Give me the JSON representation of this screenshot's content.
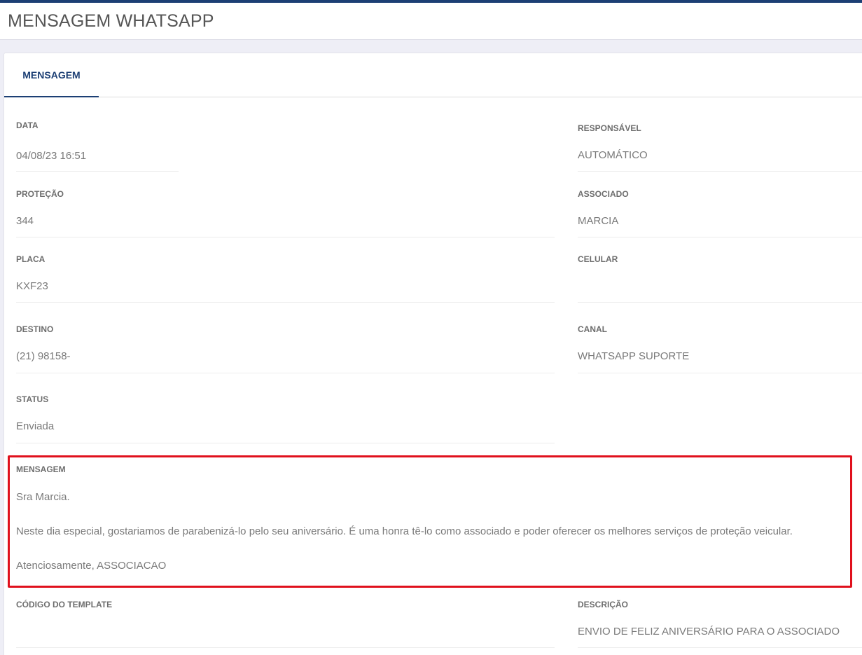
{
  "header": {
    "title": "MENSAGEM WHATSAPP"
  },
  "tabs": [
    {
      "label": "MENSAGEM"
    }
  ],
  "fields": {
    "data": {
      "label": "DATA",
      "value": "04/08/23 16:51"
    },
    "responsavel": {
      "label": "RESPONSÁVEL",
      "value": "AUTOMÁTICO"
    },
    "protecao": {
      "label": "PROTEÇÃO",
      "value": "344"
    },
    "associado": {
      "label": "ASSOCIADO",
      "value": "MARCIA"
    },
    "placa": {
      "label": "PLACA",
      "value": "KXF23"
    },
    "celular": {
      "label": "CELULAR",
      "value": ""
    },
    "destino": {
      "label": "DESTINO",
      "value": "(21) 98158-"
    },
    "canal": {
      "label": "CANAL",
      "value": "WHATSAPP SUPORTE"
    },
    "status": {
      "label": "STATUS",
      "value": "Enviada"
    },
    "codigo_template": {
      "label": "CÓDIGO DO TEMPLATE",
      "value": ""
    },
    "descricao": {
      "label": "DESCRIÇÃO",
      "value": "ENVIO DE FELIZ ANIVERSÁRIO PARA O ASSOCIADO"
    }
  },
  "mensagem": {
    "label": "MENSAGEM",
    "lines": [
      "Sra Marcia.",
      "Neste dia especial, gostariamos de parabenizá-lo pelo seu aniversário. É uma honra tê-lo como associado e poder oferecer os melhores serviços de proteção veicular.",
      "Atenciosamente, ASSOCIACAO"
    ]
  },
  "colors": {
    "accent": "#1c3f74",
    "highlight": "#e0101c"
  }
}
